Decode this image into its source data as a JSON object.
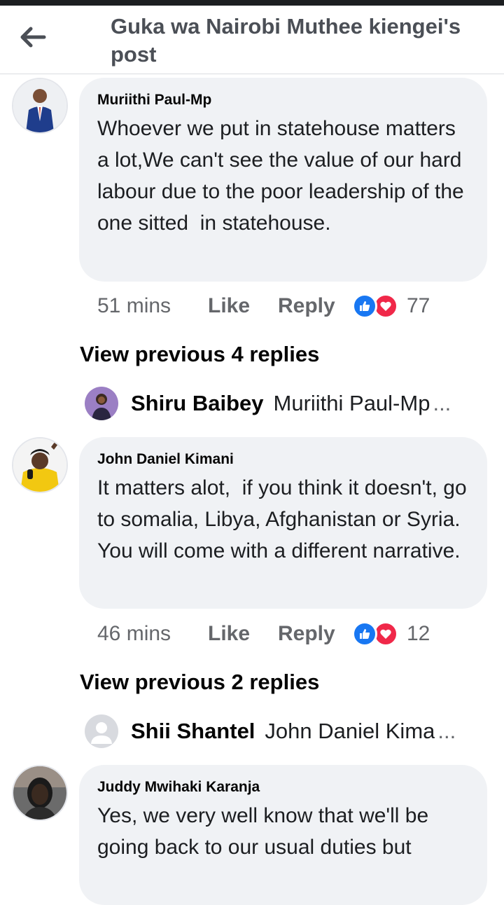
{
  "header": {
    "title": "Guka wa Nairobi Muthee kiengei's post"
  },
  "comments": [
    {
      "author": "Muriithi Paul-Mp",
      "text": "Whoever we put in statehouse matters a lot,We can't see the value of our hard labour due to the poor leadership of the one sitted  in statehouse.",
      "time": "51 mins",
      "like_label": "Like",
      "reply_label": "Reply",
      "reaction_count": "77",
      "view_previous": "View previous 4 replies",
      "reply_preview": {
        "name": "Shiru Baibey",
        "snippet": "Muriithi Paul-Mp",
        "ellipsis": "..."
      }
    },
    {
      "author": "John Daniel Kimani",
      "text": "It matters alot,  if you think it doesn't, go to somalia, Libya, Afghanistan or Syria. You will come with a different narrative.",
      "time": "46 mins",
      "like_label": "Like",
      "reply_label": "Reply",
      "reaction_count": "12",
      "view_previous": "View previous 2 replies",
      "reply_preview": {
        "name": "Shii Shantel",
        "snippet": "John Daniel Kima",
        "ellipsis": "..."
      }
    },
    {
      "author": "Juddy Mwihaki Karanja",
      "text": "Yes, we very well know that we'll be going back to our usual duties but"
    }
  ],
  "colors": {
    "like_blue": "#1877f2",
    "love_red": "#f02849",
    "bubble_bg": "#f0f2f5",
    "meta_grey": "#65676b"
  },
  "icons": {
    "back": "arrow-left-icon",
    "like": "thumbs-up-icon",
    "love": "heart-icon",
    "default_avatar": "person-silhouette-icon"
  }
}
